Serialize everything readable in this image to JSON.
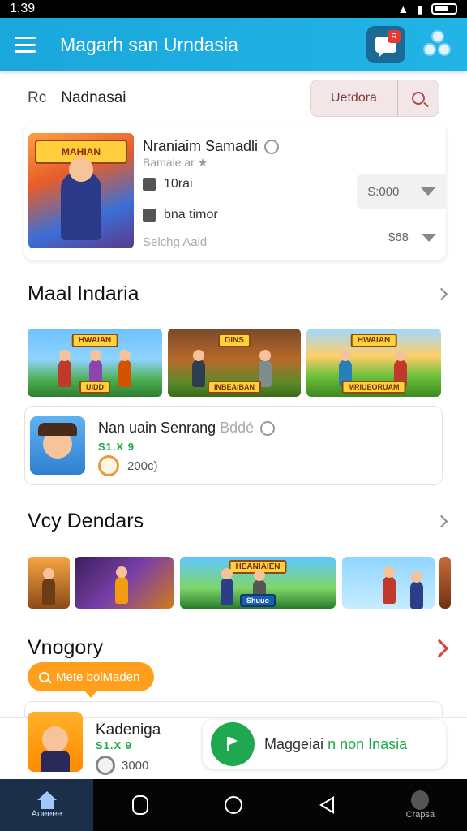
{
  "status": {
    "time": "1:39"
  },
  "appbar": {
    "title": "Magarh san Urndasia",
    "chat_badge": "R"
  },
  "search": {
    "prefix": "Rc",
    "value": "Nadnasai",
    "button_label": "Uetdora"
  },
  "featured": {
    "banner": "MAHIAN",
    "title": "Nraniaim Samadli",
    "subtitle": "Bamaie ar ★",
    "row1": "10rai",
    "row2": "bna timor",
    "hint": "Selchg Aaid",
    "price1": "S:000",
    "price2": "$68"
  },
  "section1": {
    "title": "Maal Indaria",
    "tiles": [
      {
        "caption": "HWAIAN",
        "sub": "UIDD"
      },
      {
        "caption": "DINS",
        "sub": "INBEAIBAN"
      },
      {
        "caption": "HWAIAN",
        "sub": "MRIUEORUAM"
      }
    ]
  },
  "game1": {
    "title": "Nan uain Senrang",
    "title_faded": "Bddé",
    "stat": "S1.X 9",
    "coins": "200c)"
  },
  "section2": {
    "title": "Vcy Dendars",
    "tile_caption": "HEANIAIEN",
    "tile_sub": "Shuuo"
  },
  "section3": {
    "title": "Vnogory",
    "pill": "Mete bolMaden"
  },
  "sticky": {
    "title": "Kadeniga",
    "stat": "S1.X 9",
    "coins": "3000",
    "promo": "Maggeiai",
    "promo_green": "n non",
    "promo_tail": "Inasia"
  },
  "navbar": {
    "home_label": "Aueeee",
    "profile_label": "Crapsa"
  },
  "colors": {
    "appbar": "#1aa7dc",
    "accent_orange": "#ff9f1c",
    "accent_green": "#1ea84a",
    "chevron_red": "#d64545"
  },
  "icons": [
    "menu-icon",
    "chat-icon",
    "people-icon",
    "search-icon",
    "smile-icon",
    "coin-icon",
    "flag-icon",
    "home-icon",
    "recents-icon",
    "circle-home-icon",
    "back-icon",
    "user-icon"
  ]
}
